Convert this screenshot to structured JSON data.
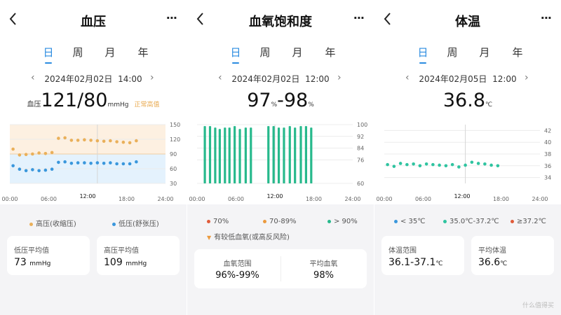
{
  "tabs": [
    "日",
    "周",
    "月",
    "年"
  ],
  "bp": {
    "title": "血压",
    "date": "2024年02月02日",
    "time": "14:00",
    "reading_label": "血压",
    "reading_value": "121/80",
    "reading_unit": "mmHg",
    "status": "正常高值",
    "legend": [
      "高压(收缩压)",
      "低压(舒张压)"
    ],
    "card1_label": "低压平均值",
    "card1_value": "73",
    "card1_unit": "mmHg",
    "card2_label": "高压平均值",
    "card2_value": "109",
    "card2_unit": "mmHg",
    "colors": {
      "systolic": "#eab05a",
      "diastolic": "#3a97dc",
      "high_band": "#fdf0e1",
      "low_band": "#e4f2fd"
    }
  },
  "spo2": {
    "title": "血氧饱和度",
    "date": "2024年02月02日",
    "time": "12:00",
    "reading_low": "97",
    "reading_high": "98",
    "reading_unit": "%",
    "legend": [
      "70%",
      "70-89%",
      "> 90%"
    ],
    "legend2": "有较低血氧(或高反风险)",
    "card1_label": "血氧范围",
    "card1_value": "96%-99%",
    "card2_label": "平均血氧",
    "card2_value": "98%",
    "colors": {
      "bar": "#27b98c",
      "low": "#e05b3a",
      "mid": "#eb9a3e",
      "high": "#27b98c"
    }
  },
  "temp": {
    "title": "体温",
    "date": "2024年02月05日",
    "time": "12:00",
    "reading_value": "36.8",
    "reading_unit": "℃",
    "legend": [
      "< 35℃",
      "35.0℃-37.2℃",
      "≥37.2℃"
    ],
    "card1_label": "体温范围",
    "card1_value": "36.1-37.1",
    "card1_unit": "℃",
    "card2_label": "平均体温",
    "card2_value": "36.6",
    "card2_unit": "℃",
    "colors": {
      "dot": "#2fc4a0",
      "low": "#3a97dc",
      "mid": "#2fc4a0",
      "high": "#e05b3a"
    }
  },
  "watermark": "什么值得买",
  "chart_data": [
    {
      "type": "scatter",
      "title": "血压",
      "x_ticks": [
        "00:00",
        "06:00",
        "12:00",
        "18:00",
        "24:00"
      ],
      "y_ticks": [
        150,
        120,
        90,
        60,
        30
      ],
      "ylim": [
        30,
        150
      ],
      "series": [
        {
          "name": "高压(收缩压)",
          "x": [
            0.5,
            1.5,
            2.5,
            3.5,
            4.5,
            5.5,
            6.5,
            7.5,
            8.5,
            9.5,
            10.5,
            11.5,
            12.5,
            13.5,
            14.5,
            15.5,
            16.5,
            17.5,
            18.5,
            19.5
          ],
          "y": [
            100,
            88,
            89,
            90,
            92,
            91,
            93,
            122,
            123,
            118,
            118,
            119,
            118,
            117,
            116,
            117,
            115,
            114,
            113,
            117
          ]
        },
        {
          "name": "低压(舒张压)",
          "x": [
            0.5,
            1.5,
            2.5,
            3.5,
            4.5,
            5.5,
            6.5,
            7.5,
            8.5,
            9.5,
            10.5,
            11.5,
            12.5,
            13.5,
            14.5,
            15.5,
            16.5,
            17.5,
            18.5,
            19.5
          ],
          "y": [
            66,
            59,
            56,
            58,
            56,
            57,
            59,
            73,
            74,
            71,
            72,
            72,
            71,
            72,
            71,
            72,
            70,
            70,
            70,
            74
          ]
        }
      ]
    },
    {
      "type": "bar",
      "title": "血氧饱和度",
      "x_ticks": [
        "00:00",
        "06:00",
        "12:00",
        "18:00",
        "24:00"
      ],
      "y_ticks": [
        100,
        92,
        84,
        76,
        60
      ],
      "ylim": [
        60,
        100
      ],
      "ranges": [
        [
          60,
          99
        ],
        [
          60,
          99
        ],
        [
          60,
          98
        ],
        [
          60,
          97
        ],
        [
          60,
          98
        ],
        [
          60,
          98
        ],
        [
          60,
          99
        ],
        [
          60,
          97
        ],
        [
          60,
          98
        ],
        [
          60,
          98
        ],
        [
          60,
          99
        ],
        [
          60,
          99
        ],
        [
          60,
          98
        ],
        [
          60,
          98
        ],
        [
          60,
          99
        ],
        [
          60,
          98
        ],
        [
          60,
          99
        ],
        [
          60,
          99
        ],
        [
          60,
          98
        ]
      ],
      "x": [
        1.2,
        2.0,
        2.8,
        3.5,
        4.3,
        5.0,
        5.8,
        6.6,
        7.5,
        8.3,
        11.0,
        11.8,
        12.6,
        13.4,
        14.3,
        15.1,
        16.0,
        16.8,
        17.6
      ]
    },
    {
      "type": "scatter",
      "title": "体温",
      "x_ticks": [
        "00:00",
        "06:00",
        "12:00",
        "18:00",
        "24:00"
      ],
      "y_ticks": [
        42,
        40,
        38,
        36,
        34
      ],
      "ylim": [
        33,
        43
      ],
      "series": [
        {
          "name": "体温",
          "x": [
            0.5,
            1.5,
            2.5,
            3.5,
            4.5,
            5.5,
            6.5,
            7.5,
            8.5,
            9.5,
            10.5,
            11.5,
            12.5,
            13.5,
            14.5,
            15.5,
            16.5,
            17.5
          ],
          "y": [
            36.2,
            35.9,
            36.4,
            36.2,
            36.3,
            36.0,
            36.3,
            36.2,
            36.1,
            36.0,
            36.2,
            35.8,
            36.1,
            36.6,
            36.4,
            36.3,
            36.1,
            36.0
          ]
        }
      ]
    }
  ]
}
